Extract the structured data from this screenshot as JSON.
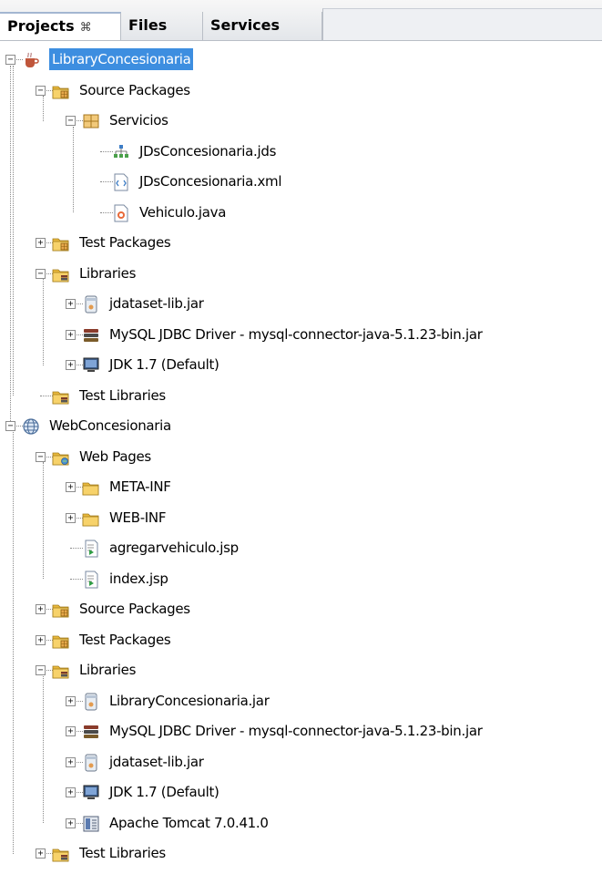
{
  "tabs": [
    {
      "label": "Projects",
      "close": "⌘"
    },
    {
      "label": "Files"
    },
    {
      "label": "Services"
    }
  ],
  "tree": [
    {
      "label": "LibraryConcesionaria",
      "level": 0,
      "toggle": "minus",
      "icon": "coffee-cup-project-icon",
      "selected": true
    },
    {
      "label": "Source Packages",
      "level": 1,
      "toggle": "minus",
      "icon": "source-packages-folder-icon"
    },
    {
      "label": "Servicios",
      "level": 2,
      "toggle": "minus",
      "icon": "package-icon"
    },
    {
      "label": "JDsConcesionaria.jds",
      "level": 3,
      "toggle": "",
      "icon": "jds-file-icon"
    },
    {
      "label": "JDsConcesionaria.xml",
      "level": 3,
      "toggle": "",
      "icon": "xml-file-icon"
    },
    {
      "label": "Vehiculo.java",
      "level": 3,
      "toggle": "",
      "icon": "java-file-icon"
    },
    {
      "label": "Test Packages",
      "level": 1,
      "toggle": "plus",
      "icon": "test-packages-folder-icon"
    },
    {
      "label": "Libraries",
      "level": 1,
      "toggle": "minus",
      "icon": "libraries-folder-icon"
    },
    {
      "label": "jdataset-lib.jar",
      "level": 2,
      "toggle": "plus",
      "icon": "jar-file-icon"
    },
    {
      "label": "MySQL JDBC Driver - mysql-connector-java-5.1.23-bin.jar",
      "level": 2,
      "toggle": "plus",
      "icon": "books-library-icon"
    },
    {
      "label": "JDK 1.7 (Default)",
      "level": 2,
      "toggle": "plus",
      "icon": "monitor-jdk-icon"
    },
    {
      "label": "Test Libraries",
      "level": 1,
      "toggle": "",
      "icon": "test-libraries-folder-icon"
    },
    {
      "label": "WebConcesionaria",
      "level": 0,
      "toggle": "minus",
      "icon": "globe-web-project-icon"
    },
    {
      "label": "Web Pages",
      "level": 1,
      "toggle": "minus",
      "icon": "web-pages-folder-icon"
    },
    {
      "label": "META-INF",
      "level": 2,
      "toggle": "plus",
      "icon": "folder-icon"
    },
    {
      "label": "WEB-INF",
      "level": 2,
      "toggle": "plus",
      "icon": "folder-icon"
    },
    {
      "label": "agregarvehiculo.jsp",
      "level": 2,
      "toggle": "",
      "icon": "jsp-file-icon"
    },
    {
      "label": "index.jsp",
      "level": 2,
      "toggle": "",
      "icon": "jsp-file-icon"
    },
    {
      "label": "Source Packages",
      "level": 1,
      "toggle": "plus",
      "icon": "source-packages-folder-icon"
    },
    {
      "label": "Test Packages",
      "level": 1,
      "toggle": "plus",
      "icon": "test-packages-folder-icon"
    },
    {
      "label": "Libraries",
      "level": 1,
      "toggle": "minus",
      "icon": "libraries-folder-icon"
    },
    {
      "label": "LibraryConcesionaria.jar",
      "level": 2,
      "toggle": "plus",
      "icon": "jar-file-icon"
    },
    {
      "label": "MySQL JDBC Driver - mysql-connector-java-5.1.23-bin.jar",
      "level": 2,
      "toggle": "plus",
      "icon": "books-library-icon"
    },
    {
      "label": "jdataset-lib.jar",
      "level": 2,
      "toggle": "plus",
      "icon": "jar-file-icon"
    },
    {
      "label": "JDK 1.7 (Default)",
      "level": 2,
      "toggle": "plus",
      "icon": "monitor-jdk-icon"
    },
    {
      "label": "Apache Tomcat 7.0.41.0",
      "level": 2,
      "toggle": "plus",
      "icon": "server-library-icon"
    },
    {
      "label": "Test Libraries",
      "level": 1,
      "toggle": "plus",
      "icon": "test-libraries-folder-icon"
    }
  ]
}
